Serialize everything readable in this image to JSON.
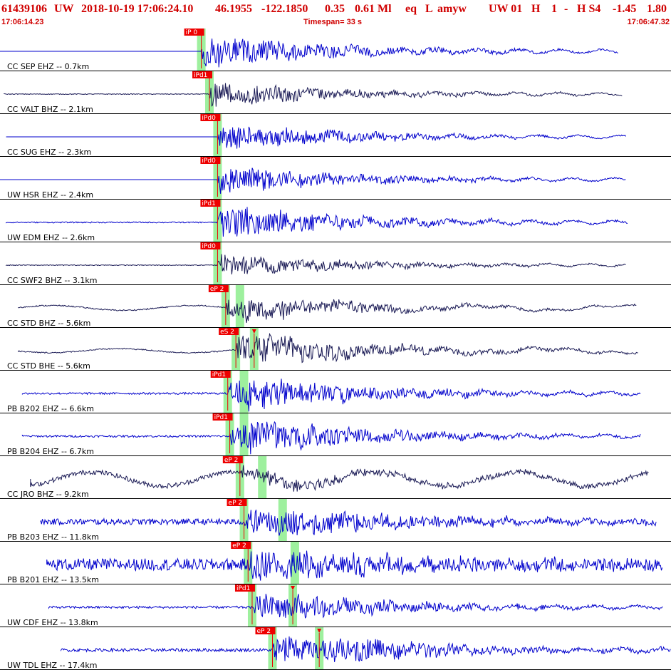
{
  "header": {
    "event_id": "61439106",
    "network": "UW",
    "datetime": "2018-10-19 17:06:24.10",
    "lat": "46.1955",
    "lon": "-122.1850",
    "depth": "0.35",
    "magnitude": "0.61 Ml",
    "etype": "eq",
    "gtype": "L",
    "analyst": "amyw",
    "source": "UW 01",
    "quality": "H",
    "version": "1",
    "dash": "-",
    "state": "H S4",
    "val1": "-1.45",
    "val2": "1.80"
  },
  "subheader": {
    "start_time": "17:06:14.23",
    "timespan": "Timespan=  33 s",
    "end_time": "17:06:47.32"
  },
  "colors": {
    "header_text": "#d00000",
    "pick_box": "#ee0000",
    "pick_window": "#9ef09e",
    "trace_blue": "#0000cc",
    "trace_dark": "#1a1a55",
    "grid": "#000000"
  },
  "timespan_seconds": 33,
  "traces": [
    {
      "label": "CC SEP EHZ -- 0.7km",
      "color": "blue",
      "amp": 0.75,
      "noise": 0.0,
      "longwave": 0,
      "pick": "iP 0",
      "p_time": 9.9,
      "s_time": null,
      "end_time": 30.4,
      "start_time": 0.0
    },
    {
      "label": "CC VALT BHZ -- 2.1km",
      "color": "dark",
      "amp": 0.55,
      "noise": 0.02,
      "longwave": 0,
      "pick": "iPd1",
      "p_time": 10.3,
      "s_time": null,
      "end_time": 30.6,
      "start_time": 0.2
    },
    {
      "label": "CC SUG EHZ -- 2.3km",
      "color": "blue",
      "amp": 0.6,
      "noise": 0.0,
      "longwave": 0,
      "pick": "iPd0",
      "p_time": 10.7,
      "s_time": null,
      "end_time": 30.8,
      "start_time": 0.3
    },
    {
      "label": "UW HSR EHZ -- 2.4km",
      "color": "blue",
      "amp": 0.65,
      "noise": 0.0,
      "longwave": 0,
      "pick": "iPd0",
      "p_time": 10.7,
      "s_time": null,
      "end_time": 30.8,
      "start_time": 0.0
    },
    {
      "label": "UW EDM EHZ -- 2.6km",
      "color": "blue",
      "amp": 0.75,
      "noise": 0.03,
      "longwave": 0,
      "pick": "iPd1",
      "p_time": 10.7,
      "s_time": null,
      "end_time": 30.9,
      "start_time": 0.3
    },
    {
      "label": "CC SWF2 BHZ -- 3.1km",
      "color": "dark",
      "amp": 0.5,
      "noise": 0.02,
      "longwave": 0,
      "pick": "iPd0",
      "p_time": 10.7,
      "s_time": null,
      "end_time": 30.8,
      "start_time": 0.3
    },
    {
      "label": "CC STD BHZ -- 5.6km",
      "color": "dark",
      "amp": 0.45,
      "noise": 0.03,
      "longwave": 0.12,
      "pick": "eP 2",
      "p_time": 11.1,
      "s_time": 11.8,
      "end_time": 31.3,
      "start_time": 0.9
    },
    {
      "label": "CC STD BHE -- 5.6km",
      "color": "dark",
      "amp": 0.6,
      "noise": 0.03,
      "longwave": 0.1,
      "pick": "eS 2",
      "p_time": 11.6,
      "s_time": 12.5,
      "end_time": 31.4,
      "start_time": 0.9
    },
    {
      "label": "PB B202 EHZ -- 6.6km",
      "color": "blue",
      "amp": 0.65,
      "noise": 0.05,
      "longwave": 0,
      "pick": "iPd1",
      "p_time": 11.2,
      "s_time": 12.0,
      "end_time": 31.5,
      "start_time": 1.1
    },
    {
      "label": "PB B204 EHZ -- 6.7km",
      "color": "blue",
      "amp": 0.65,
      "noise": 0.05,
      "longwave": 0,
      "pick": "iPd1",
      "p_time": 11.3,
      "s_time": 12.0,
      "end_time": 31.5,
      "start_time": 1.1
    },
    {
      "label": "CC JRO BHZ -- 9.2km",
      "color": "dark",
      "amp": 0.25,
      "noise": 0.12,
      "longwave": 0.35,
      "pick": "eP 2",
      "p_time": 11.8,
      "s_time": 12.9,
      "end_time": 31.9,
      "start_time": 1.5
    },
    {
      "label": "PB B203 EHZ -- 11.8km",
      "color": "blue",
      "amp": 0.6,
      "noise": 0.15,
      "longwave": 0,
      "pick": "eP 2",
      "p_time": 12.0,
      "s_time": 13.9,
      "end_time": 32.3,
      "start_time": 2.0
    },
    {
      "label": "PB B201 EHZ -- 13.5km",
      "color": "blue",
      "amp": 0.6,
      "noise": 0.3,
      "longwave": 0,
      "pick": "eP 2",
      "p_time": 12.2,
      "s_time": 14.5,
      "end_time": 32.6,
      "start_time": 2.3
    },
    {
      "label": "UW CDF EHZ -- 13.8km",
      "color": "blue",
      "amp": 0.55,
      "noise": 0.06,
      "longwave": 0,
      "pick": "iPd1",
      "p_time": 12.4,
      "s_time": 14.4,
      "end_time": 32.6,
      "start_time": 2.4
    },
    {
      "label": "UW TDL EHZ -- 17.4km",
      "color": "blue",
      "amp": 0.65,
      "noise": 0.08,
      "longwave": 0,
      "pick": "eP 2",
      "p_time": 13.4,
      "s_time": 15.7,
      "end_time": 33.0,
      "start_time": 3.0
    }
  ]
}
